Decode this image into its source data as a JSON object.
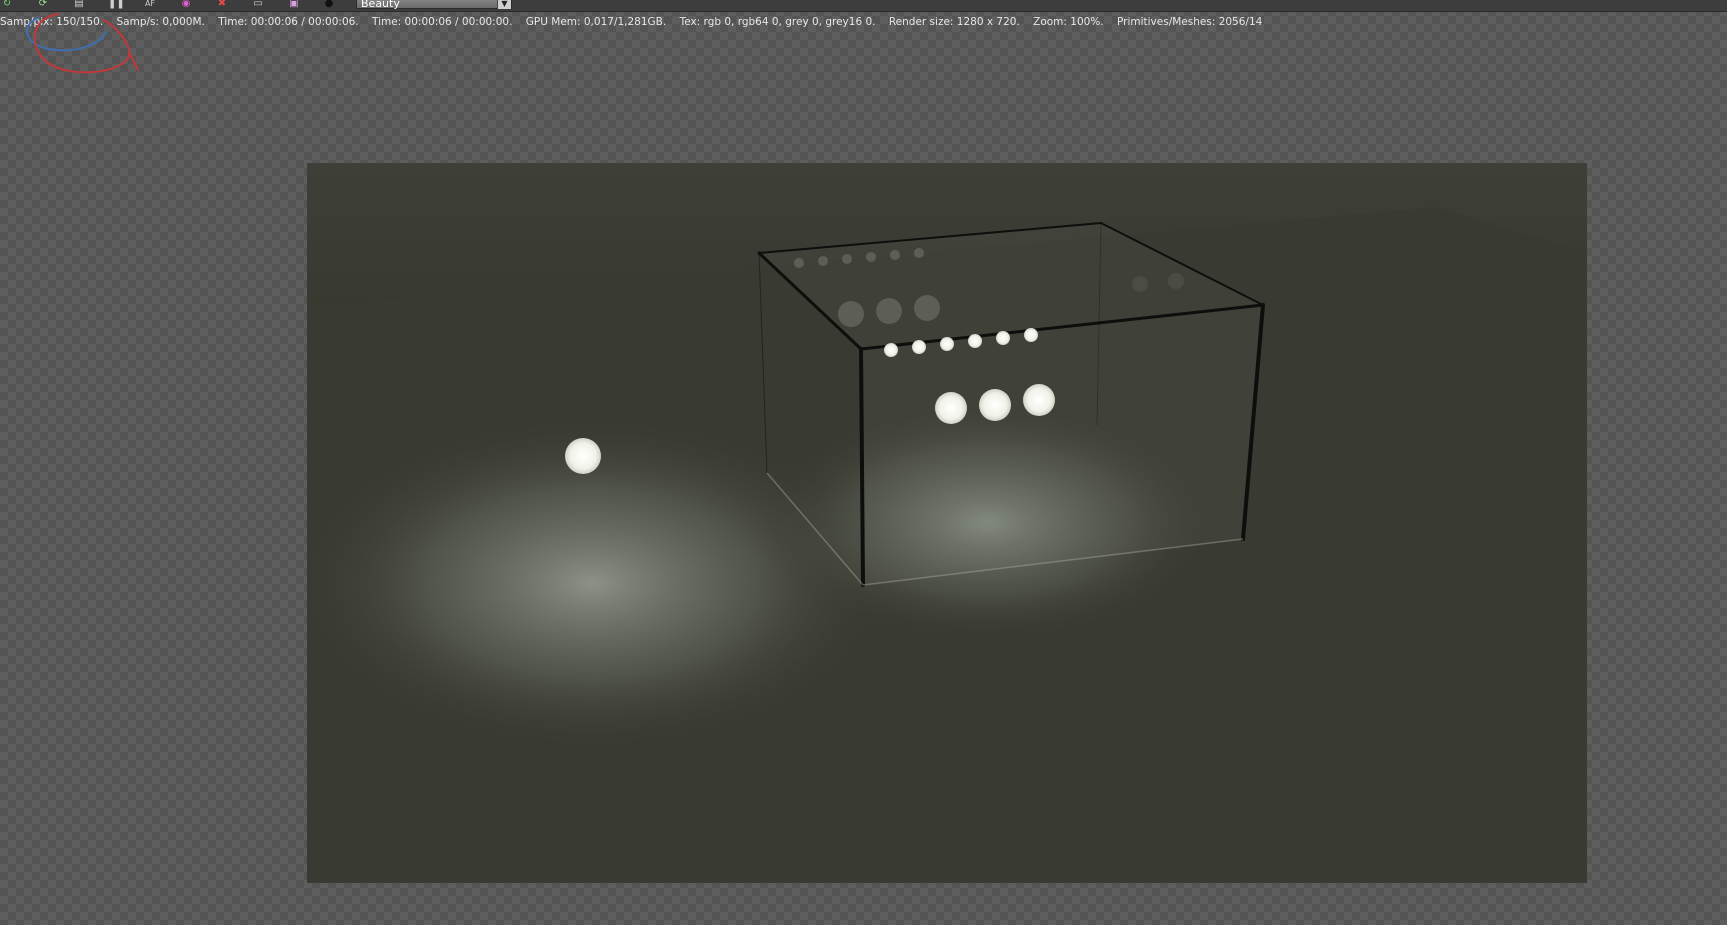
{
  "toolbar": {
    "icons": [
      "back-icon",
      "refresh-icon",
      "save-icon",
      "pause-icon",
      "af-icon",
      "color-icon",
      "clear-icon",
      "settings-icon",
      "export-icon",
      "camera-icon"
    ],
    "af_label": "AF",
    "pass": {
      "selected": "Beauty"
    }
  },
  "status": {
    "samp_pix": "Samp/pix: 150/150.",
    "samp_s": "Samp/s: 0,000M.",
    "time1": "Time: 00:00:06 / 00:00:06.",
    "time2": "Time: 00:00:06 / 00:00:00.",
    "gpu_mem": "GPU Mem: 0,017/1,281GB.",
    "tex": "Tex: rgb 0, rgb64 0, grey 0, grey16 0.",
    "render_size": "Render size: 1280 x 720.",
    "zoom": "Zoom: 100%.",
    "primitives": "Primitives/Meshes: 2056/14"
  },
  "colors": {
    "floor": "#3a3b32",
    "sphere": "#f4f4ee",
    "glass_edge": "#0e0f0c",
    "annot_red": "#c0393b",
    "annot_blue": "#3f6fb0"
  }
}
